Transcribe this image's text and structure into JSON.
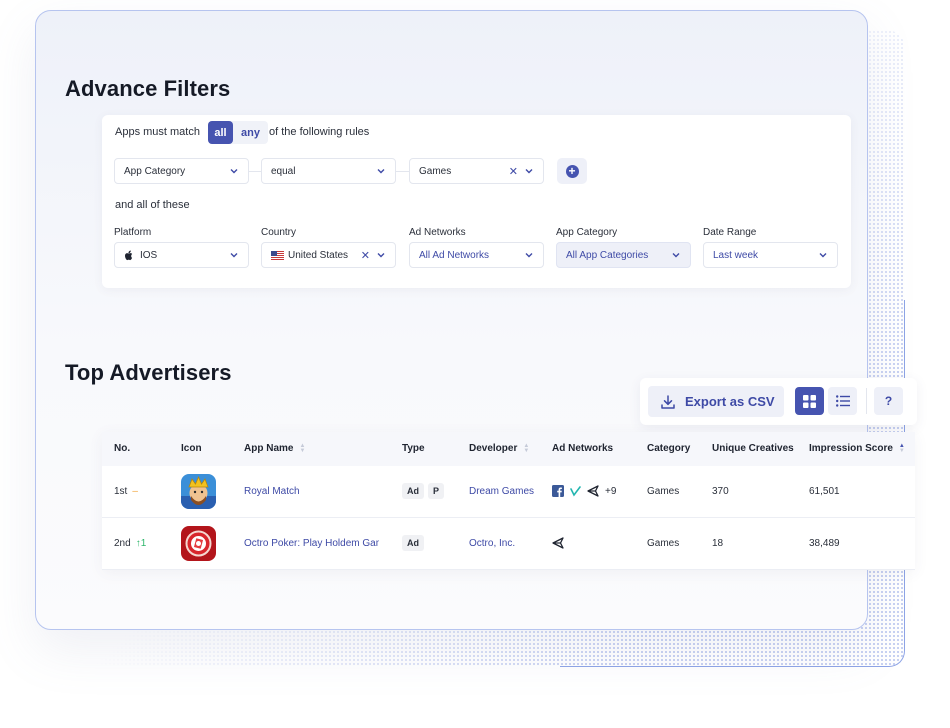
{
  "filters": {
    "title": "Advance Filters",
    "match_prefix": "Apps must match",
    "match_all": "all",
    "match_any": "any",
    "match_suffix": "of the following rules",
    "rule": {
      "field": "App Category",
      "operator": "equal",
      "value": "Games"
    },
    "and_all_label": "and all of these",
    "platform": {
      "label": "Platform",
      "value": "IOS"
    },
    "country": {
      "label": "Country",
      "value": "United States"
    },
    "ad_networks": {
      "label": "Ad Networks",
      "value": "All Ad Networks"
    },
    "app_category": {
      "label": "App Category",
      "value": "All App Categories"
    },
    "date_range": {
      "label": "Date Range",
      "value": "Last week"
    }
  },
  "advertisers": {
    "title": "Top Advertisers",
    "export_label": "Export as CSV",
    "help_label": "?",
    "columns": [
      "No.",
      "Icon",
      "App Name",
      "Type",
      "Developer",
      "Ad Networks",
      "Category",
      "Unique Creatives",
      "Impression Score"
    ],
    "rows": [
      {
        "rank": "1st",
        "change": "–",
        "app_name": "Royal Match",
        "types": [
          "Ad",
          "P"
        ],
        "developer": "Dream Games",
        "networks_extra": "+9",
        "category": "Games",
        "unique_creatives": "370",
        "impression_score": "61,501"
      },
      {
        "rank": "2nd",
        "change": "↑1",
        "app_name": "Octro Poker: Play Holdem Gam",
        "types": [
          "Ad"
        ],
        "developer": "Octro, Inc.",
        "networks_extra": "",
        "category": "Games",
        "unique_creatives": "18",
        "impression_score": "38,489"
      }
    ]
  },
  "colors": {
    "accent": "#4654b0",
    "accent_text": "#3e4aa6",
    "up": "#2eb66b",
    "neutral": "#f0a742"
  },
  "icons": [
    "chevron-down-icon",
    "close-icon",
    "plus-circle-icon",
    "apple-icon",
    "us-flag-icon",
    "download-icon",
    "grid-view-icon",
    "list-view-icon",
    "facebook-icon",
    "vungle-icon",
    "unity-icon",
    "sort-icon"
  ]
}
